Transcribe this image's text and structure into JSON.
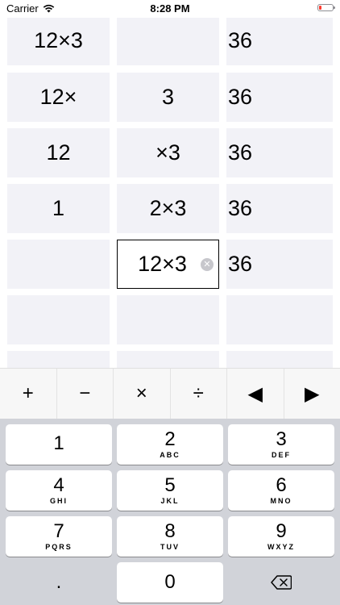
{
  "status": {
    "carrier": "Carrier",
    "time": "8:28 PM"
  },
  "rows": [
    {
      "a": "12×3",
      "b": "",
      "result": "36"
    },
    {
      "a": "12×",
      "b": "3",
      "result": "36"
    },
    {
      "a": "12",
      "b": "×3",
      "result": "36"
    },
    {
      "a": "1",
      "b": "2×3",
      "result": "36"
    },
    {
      "a": "",
      "b": "12×3",
      "result": "36"
    },
    {
      "a": "",
      "b": "",
      "result": ""
    },
    {
      "a": "",
      "b": "",
      "result": ""
    }
  ],
  "operators": [
    "+",
    "−",
    "×",
    "÷",
    "◀",
    "▶"
  ],
  "keys": [
    {
      "num": "1",
      "sub": ""
    },
    {
      "num": "2",
      "sub": "ABC"
    },
    {
      "num": "3",
      "sub": "DEF"
    },
    {
      "num": "4",
      "sub": "GHI"
    },
    {
      "num": "5",
      "sub": "JKL"
    },
    {
      "num": "6",
      "sub": "MNO"
    },
    {
      "num": "7",
      "sub": "PQRS"
    },
    {
      "num": "8",
      "sub": "TUV"
    },
    {
      "num": "9",
      "sub": "WXYZ"
    },
    {
      "num": ".",
      "sub": ""
    },
    {
      "num": "0",
      "sub": ""
    }
  ],
  "icons": {
    "wifi": "wifi-icon",
    "battery": "battery-low-icon",
    "clear": "clear-circle-icon",
    "backspace": "backspace-icon"
  },
  "colors": {
    "cell": "#f2f2f7",
    "keypad": "#d1d3d9",
    "battery_low": "#ff3b30"
  }
}
